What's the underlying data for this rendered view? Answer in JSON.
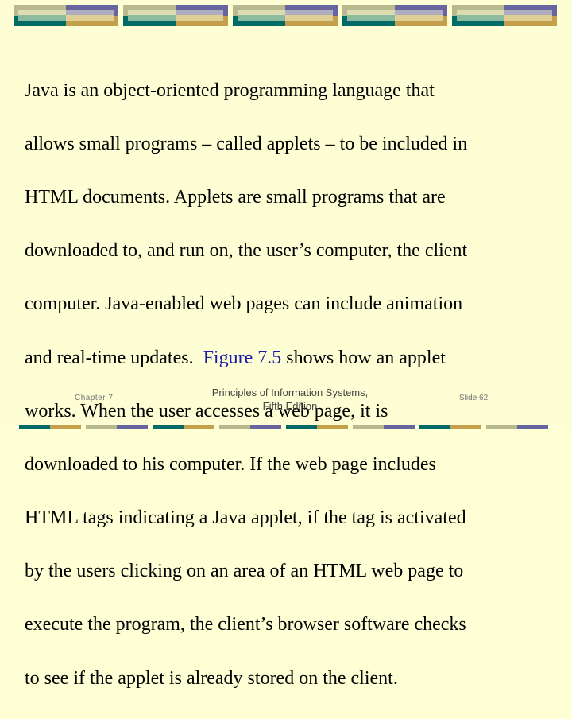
{
  "slide": {
    "body_lines": [
      "Java is an object-oriented programming language that",
      "allows small programs – called applets – to be included in",
      "HTML documents.  Applets are small programs that are",
      "downloaded to, and run on,  the user’s computer, the client",
      "computer.  Java-enabled web pages can include animation",
      "and real-time updates.  ",
      "works. When the user accesses a web page, it is",
      "downloaded to his computer.  If the web page includes",
      "HTML tags indicating a Java applet, if the tag is activated",
      "by the users clicking on an area of an HTML web page to",
      "execute the program, the client’s browser software checks",
      "to see if the applet is already stored on the client."
    ],
    "line6_link": "Figure 7.5",
    "line6_tail": " shows how an applet",
    "link_color": "#1a1aa8"
  },
  "footer": {
    "chapter": "Chapter 7",
    "title_line1": "Principles of Information Systems,",
    "title_line2": "Fifth Edition",
    "slide_number": "Slide 62"
  },
  "theme": {
    "background": "#fefed5",
    "colors": [
      "#006a66",
      "#c4a04c",
      "#b9b98f",
      "#66659f"
    ]
  }
}
